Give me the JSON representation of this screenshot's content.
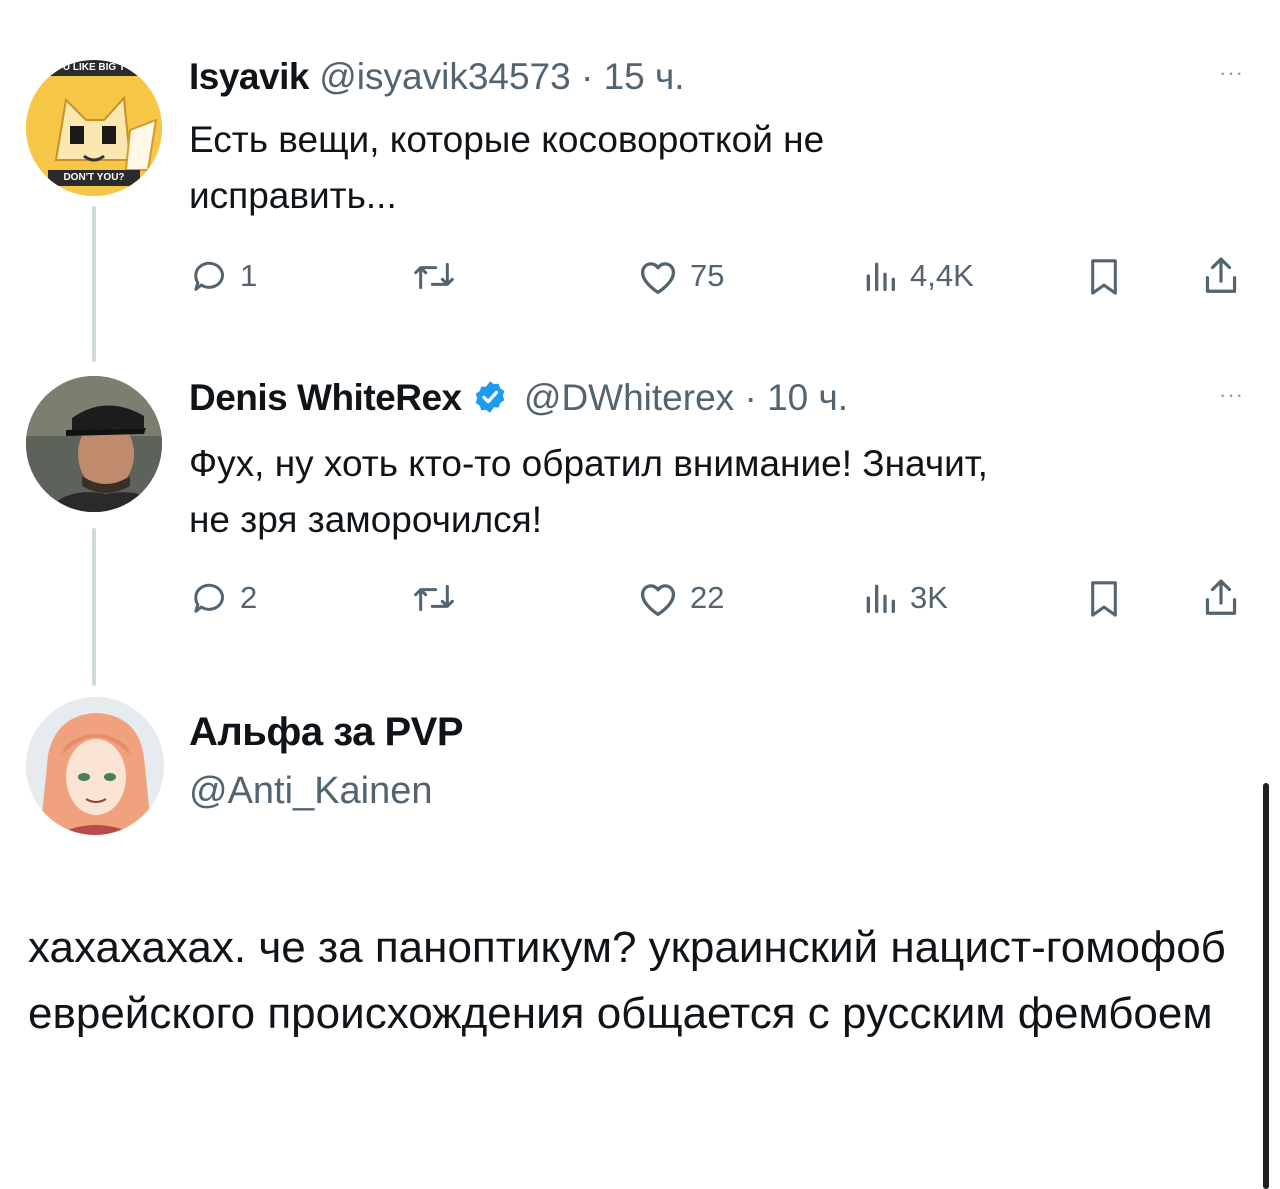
{
  "tweets": [
    {
      "name": "Isyavik",
      "handle": "@isyavik34573",
      "separator": "·",
      "time": "15 ч.",
      "text_line1": "Есть вещи, которые косовороткой не",
      "text_line2": "исправить...",
      "more": "···",
      "avatar_caption_top": "U LIKE BIG T",
      "avatar_caption_bottom": "DON'T YOU?",
      "replies": "1",
      "likes": "75",
      "views": "4,4K",
      "verified": false
    },
    {
      "name": "Denis WhiteRex",
      "handle": "@DWhiterex",
      "separator": "·",
      "time": "10 ч.",
      "text_line1": "Фух, ну хоть кто-то обратил внимание! Значит,",
      "text_line2": "не зря заморочился!",
      "more": "···",
      "replies": "2",
      "likes": "22",
      "views": "3K",
      "verified": true
    }
  ],
  "reply": {
    "name": "Альфа за PVP",
    "handle": "@Anti_Kainen",
    "text": "хахахахах. че за паноптикум? украинский нацист-гомофоб еврейского происхождения общается с русским фембоем"
  },
  "icons": [
    "reply-icon",
    "retweet-icon",
    "like-icon",
    "views-icon",
    "bookmark-icon",
    "share-icon",
    "verified-badge-icon",
    "more-icon"
  ],
  "colors": {
    "text": "#0f1419",
    "secondary": "#536471",
    "verified": "#1d9bf0",
    "thread_line": "#cfd9de"
  }
}
